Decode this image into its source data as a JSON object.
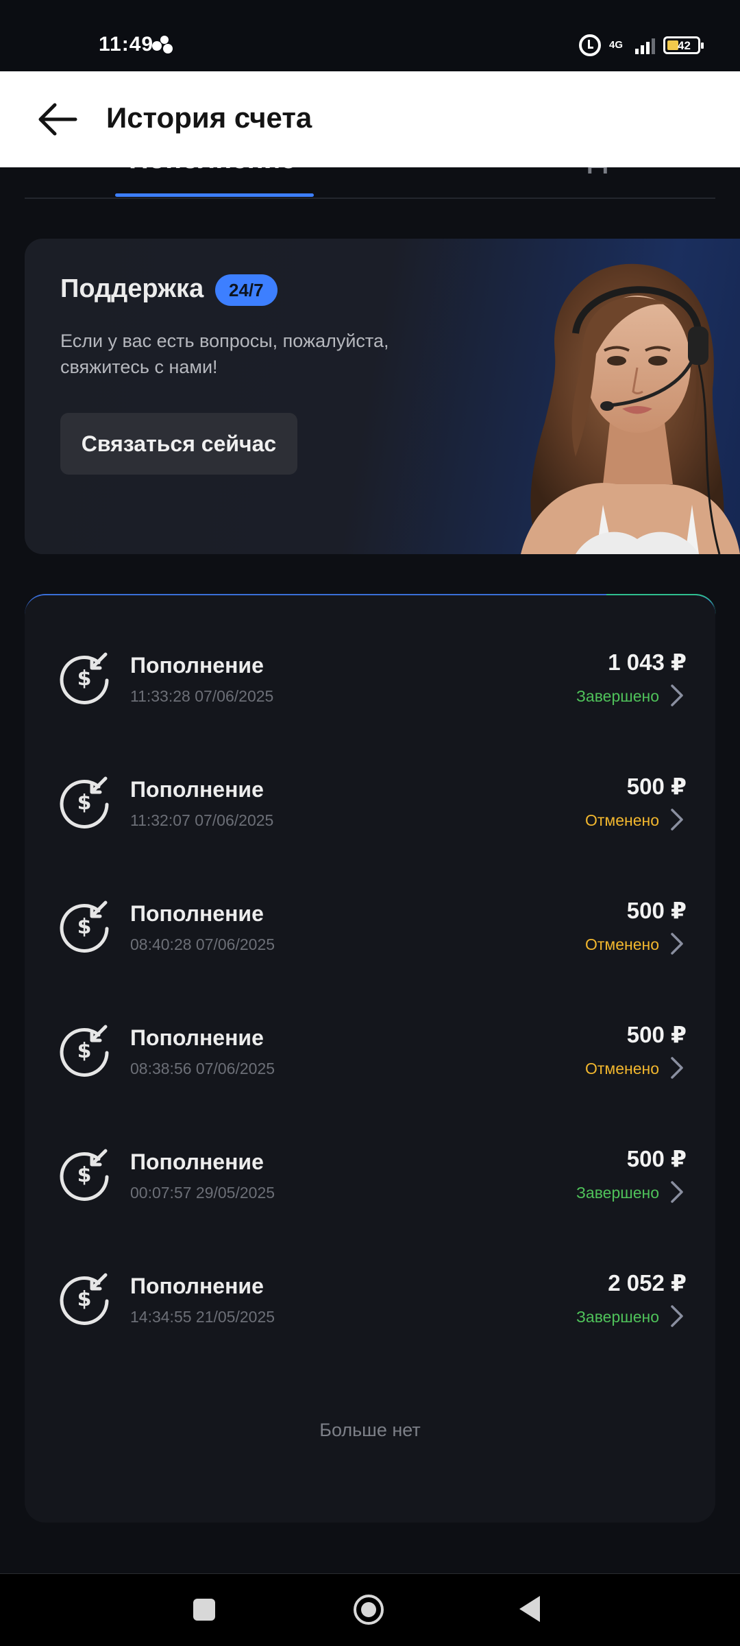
{
  "status_bar": {
    "time": "11:49",
    "network": "4G",
    "battery": "42"
  },
  "header": {
    "title": "История счета"
  },
  "tabs": [
    {
      "label": "Пополнение"
    },
    {
      "label": "Д"
    }
  ],
  "support": {
    "title": "Поддержка",
    "badge": "24/7",
    "text": "Если у вас есть вопросы, пожалуйста, свяжитесь с нами!",
    "button_label": "Связаться сейчас"
  },
  "transactions": [
    {
      "title": "Пополнение",
      "datetime": "11:33:28 07/06/2025",
      "amount": "1 043 ₽",
      "status": "Завершено"
    },
    {
      "title": "Пополнение",
      "datetime": "11:32:07 07/06/2025",
      "amount": "500 ₽",
      "status": "Отменено"
    },
    {
      "title": "Пополнение",
      "datetime": "08:40:28 07/06/2025",
      "amount": "500 ₽",
      "status": "Отменено"
    },
    {
      "title": "Пополнение",
      "datetime": "08:38:56 07/06/2025",
      "amount": "500 ₽",
      "status": "Отменено"
    },
    {
      "title": "Пополнение",
      "datetime": "00:07:57 29/05/2025",
      "amount": "500 ₽",
      "status": "Завершено"
    },
    {
      "title": "Пополнение",
      "datetime": "14:34:55 21/05/2025",
      "amount": "2 052 ₽",
      "status": "Завершено"
    }
  ],
  "list_footer": "Больше нет",
  "colors": {
    "accent": "#3d7fff",
    "completed": "#4fc25a",
    "cancelled": "#f2b72e",
    "background": "#0d0f14"
  }
}
